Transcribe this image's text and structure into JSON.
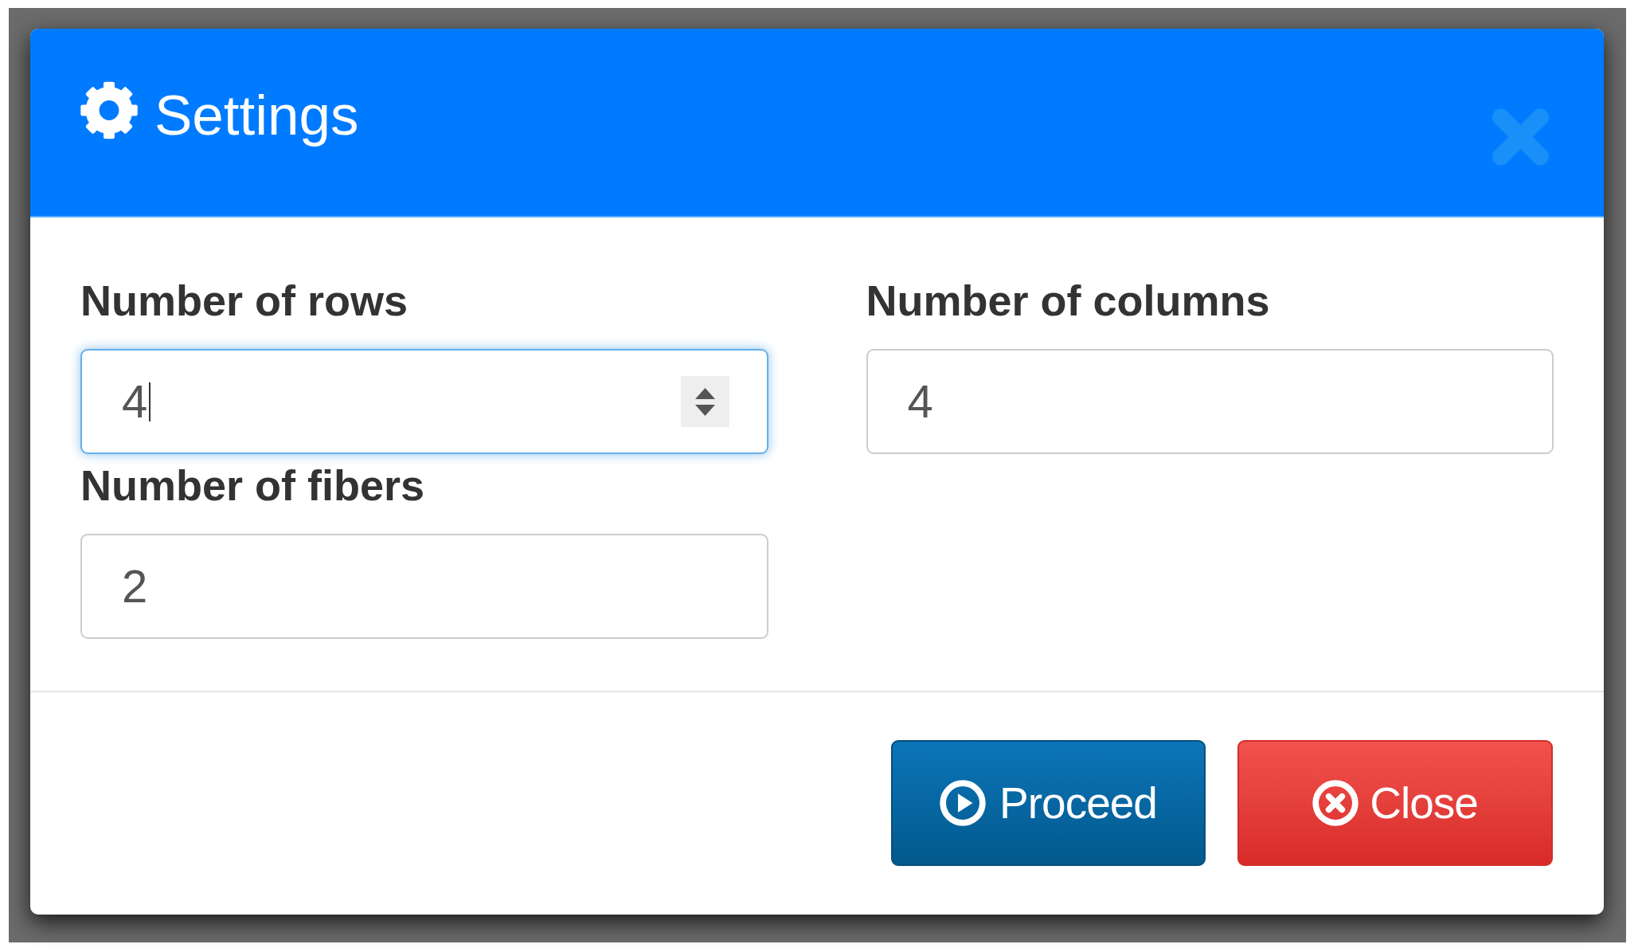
{
  "dialog": {
    "title": "Settings",
    "fields": [
      {
        "label": "Number of rows",
        "value": "4",
        "focused": true
      },
      {
        "label": "Number of columns",
        "value": "4",
        "focused": false
      },
      {
        "label": "Number of fibers",
        "value": "2",
        "focused": false
      }
    ],
    "buttons": [
      {
        "label": "Proceed",
        "kind": "primary"
      },
      {
        "label": "Close",
        "kind": "danger"
      }
    ]
  }
}
